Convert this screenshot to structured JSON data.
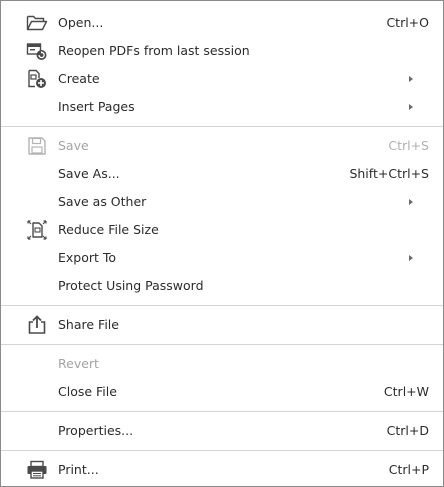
{
  "menu": {
    "open": {
      "label": "Open...",
      "shortcut": "Ctrl+O",
      "icon": "open-folder-icon"
    },
    "reopen": {
      "label": "Reopen PDFs from last session",
      "icon": "reopen-session-icon"
    },
    "create": {
      "label": "Create",
      "icon": "create-pdf-icon"
    },
    "insert_pages": {
      "label": "Insert Pages"
    },
    "save": {
      "label": "Save",
      "shortcut": "Ctrl+S",
      "icon": "save-disk-icon"
    },
    "save_as": {
      "label": "Save As...",
      "shortcut": "Shift+Ctrl+S"
    },
    "save_other": {
      "label": "Save as Other"
    },
    "reduce": {
      "label": "Reduce File Size",
      "icon": "reduce-file-size-icon"
    },
    "export": {
      "label": "Export To"
    },
    "protect": {
      "label": "Protect Using Password"
    },
    "share": {
      "label": "Share File",
      "icon": "share-icon"
    },
    "revert": {
      "label": "Revert"
    },
    "close": {
      "label": "Close File",
      "shortcut": "Ctrl+W"
    },
    "properties": {
      "label": "Properties...",
      "shortcut": "Ctrl+D"
    },
    "print": {
      "label": "Print...",
      "shortcut": "Ctrl+P",
      "icon": "printer-icon"
    }
  },
  "colors": {
    "text": "#2b2b2b",
    "disabled": "#a3a3a3",
    "separator": "#d4d4d4",
    "border": "#8a8a8a"
  }
}
